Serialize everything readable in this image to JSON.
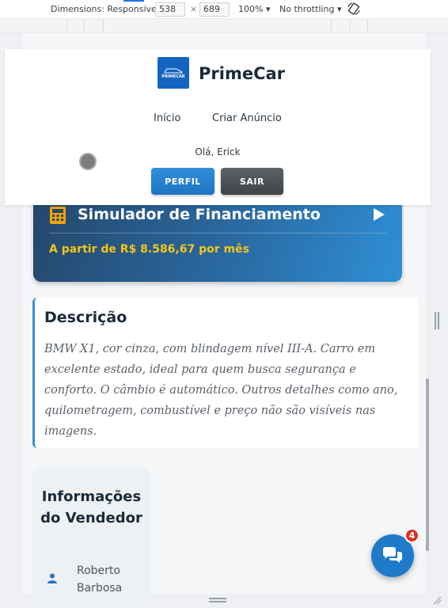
{
  "devtools": {
    "dimensions_label": "Dimensions: Responsive",
    "width": "538",
    "times": "×",
    "height": "689",
    "zoom": "100%",
    "throttling": "No throttling"
  },
  "header": {
    "brand": "PrimeCar",
    "logo_text": "PRIMECAR",
    "nav": {
      "home": "Início",
      "create_ad": "Criar Anúncio"
    },
    "greeting": "Olá, Erick",
    "profile_button": "PERFIL",
    "logout_button": "SAIR"
  },
  "simulator": {
    "title": "Simulador de Financiamento",
    "price_text": "A partir de R$ 8.586,67 por mês",
    "price_color": "#f5c518"
  },
  "description": {
    "title": "Descrição",
    "text": "BMW X1, cor cinza, com blindagem nível III-A. Carro em excelente estado, ideal para quem busca segurança e conforto. O câmbio é automático. Outros detalhes como ano, quilometragem, combustível e preço não são visíveis nas imagens."
  },
  "seller": {
    "title": "Informações do Vendedor",
    "name": "Roberto Barbosa"
  },
  "chat": {
    "badge_count": "4",
    "icon": "chat-bubbles-icon"
  },
  "colors": {
    "accent": "#1f7ac9",
    "brand": "#1565c0"
  }
}
